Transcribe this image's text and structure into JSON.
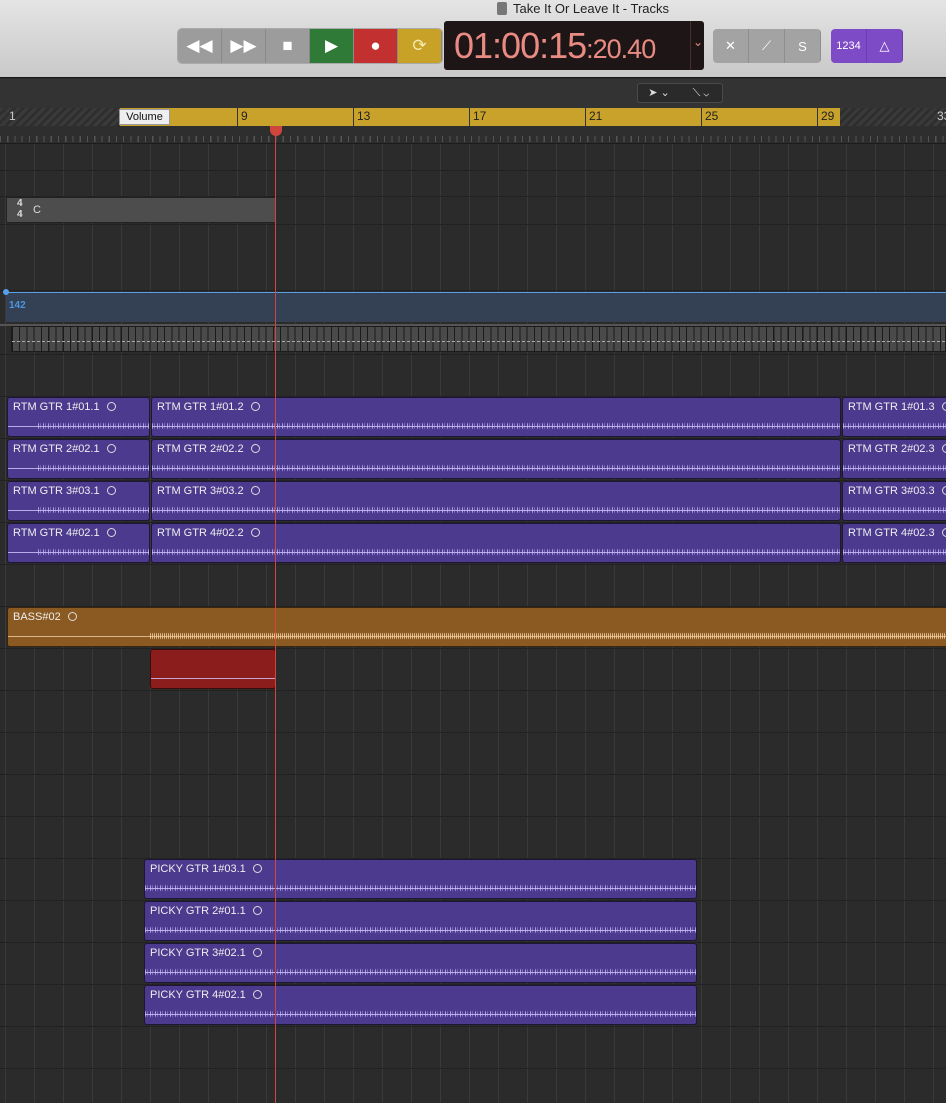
{
  "window": {
    "title": "Take It Or Leave It - Tracks"
  },
  "transport": {
    "buttons": [
      {
        "name": "rewind",
        "glyph": "◀◀"
      },
      {
        "name": "fast-forward",
        "glyph": "▶▶"
      },
      {
        "name": "stop",
        "glyph": "■"
      },
      {
        "name": "play",
        "glyph": "▶"
      },
      {
        "name": "record",
        "glyph": "●"
      },
      {
        "name": "cycle",
        "glyph": "⟳"
      }
    ],
    "colors": {
      "play": "#2f7a36",
      "record": "#c23030",
      "cycle": "#c7a227"
    }
  },
  "lcd": {
    "time_main": "01:00:15",
    "time_frames": ":20.40"
  },
  "modes": {
    "replace": "✕",
    "tuner": "⟋",
    "solo": "S",
    "count_in": "1234",
    "metronome": "♮"
  },
  "tools": {
    "pointer": "➤",
    "pointer_chev": "⌄",
    "automation": "⟍",
    "automation_chev": "⌄"
  },
  "ruler": {
    "bars": [
      "1",
      "9",
      "13",
      "17",
      "21",
      "25",
      "29",
      "33"
    ],
    "tooltip": "Volume",
    "playhead_position": "01:00:15:20.40"
  },
  "global_tracks": {
    "signature_top": "4",
    "signature_bottom": "4",
    "key": "C",
    "tempo": "142"
  },
  "regions": {
    "rtm": [
      [
        "RTM GTR 1#01.1",
        "RTM GTR 1#01.2",
        "RTM GTR 1#01.3"
      ],
      [
        "RTM GTR 2#02.1",
        "RTM GTR 2#02.2",
        "RTM GTR 2#02.3"
      ],
      [
        "RTM GTR 3#03.1",
        "RTM GTR 3#03.2",
        "RTM GTR 3#03.3"
      ],
      [
        "RTM GTR 4#02.1",
        "RTM GTR 4#02.2",
        "RTM GTR 4#02.3"
      ]
    ],
    "bass": "BASS#02",
    "picky": [
      "PICKY GTR 1#03.1",
      "PICKY GTR 2#01.1",
      "PICKY GTR 3#02.1",
      "PICKY GTR 4#02.1"
    ]
  },
  "colors": {
    "guitar_region": "#4b3a8e",
    "bass_region": "#8a5a22",
    "red_region": "#8b1d1d",
    "cycle": "#c9a22c",
    "playhead": "#d0463b",
    "tempo": "#5aa0e8"
  }
}
